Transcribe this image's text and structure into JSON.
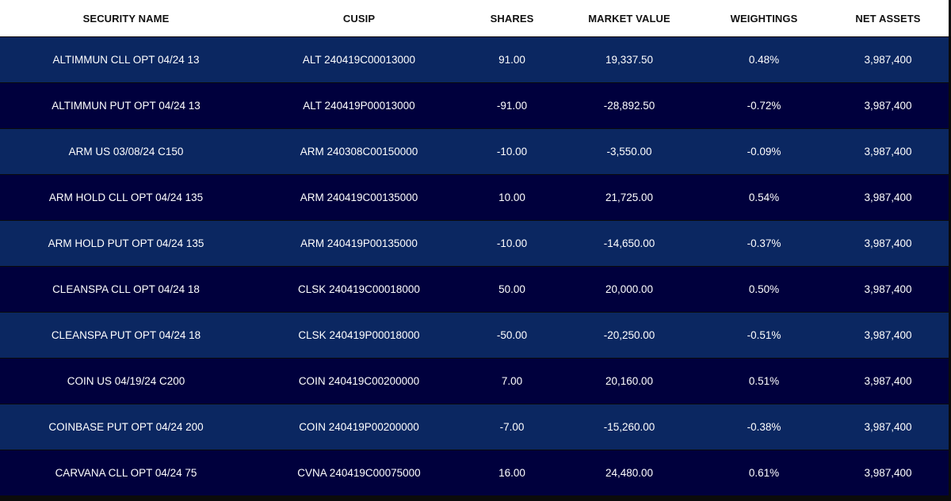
{
  "colors": {
    "header_bg": "#ffffff",
    "header_text": "#111111",
    "row_dark": "#0b2761",
    "row_bright": "#00008b",
    "body_text": "#ffffff"
  },
  "table": {
    "columns": [
      "SECURITY NAME",
      "CUSIP",
      "SHARES",
      "MARKET VALUE",
      "WEIGHTINGS",
      "NET ASSETS"
    ],
    "rows": [
      [
        "ALTIMMUN CLL OPT 04/24 13",
        "ALT 240419C00013000",
        "91.00",
        "19,337.50",
        "0.48%",
        "3,987,400"
      ],
      [
        "ALTIMMUN PUT OPT 04/24 13",
        "ALT 240419P00013000",
        "-91.00",
        "-28,892.50",
        "-0.72%",
        "3,987,400"
      ],
      [
        "ARM US 03/08/24 C150",
        "ARM 240308C00150000",
        "-10.00",
        "-3,550.00",
        "-0.09%",
        "3,987,400"
      ],
      [
        "ARM HOLD CLL OPT 04/24 135",
        "ARM 240419C00135000",
        "10.00",
        "21,725.00",
        "0.54%",
        "3,987,400"
      ],
      [
        "ARM HOLD PUT OPT 04/24 135",
        "ARM 240419P00135000",
        "-10.00",
        "-14,650.00",
        "-0.37%",
        "3,987,400"
      ],
      [
        "CLEANSPA CLL OPT 04/24 18",
        "CLSK 240419C00018000",
        "50.00",
        "20,000.00",
        "0.50%",
        "3,987,400"
      ],
      [
        "CLEANSPA PUT OPT 04/24 18",
        "CLSK 240419P00018000",
        "-50.00",
        "-20,250.00",
        "-0.51%",
        "3,987,400"
      ],
      [
        "COIN US 04/19/24 C200",
        "COIN 240419C00200000",
        "7.00",
        "20,160.00",
        "0.51%",
        "3,987,400"
      ],
      [
        "COINBASE PUT OPT 04/24 200",
        "COIN 240419P00200000",
        "-7.00",
        "-15,260.00",
        "-0.38%",
        "3,987,400"
      ],
      [
        "CARVANA CLL OPT 04/24 75",
        "CVNA 240419C00075000",
        "16.00",
        "24,480.00",
        "0.61%",
        "3,987,400"
      ]
    ]
  }
}
